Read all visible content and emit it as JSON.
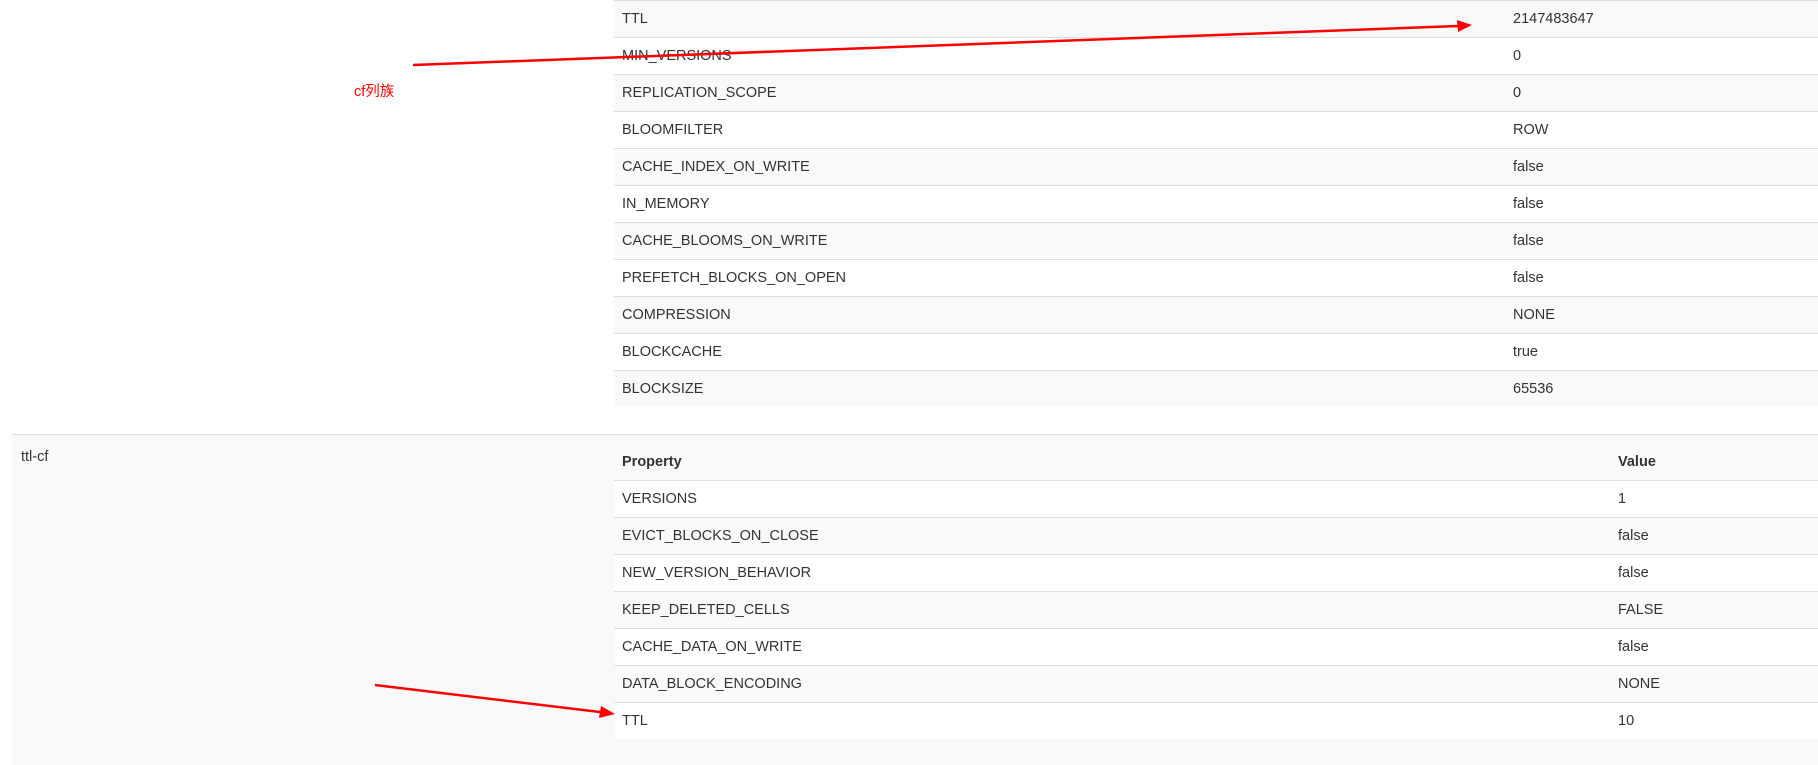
{
  "annotation": {
    "label": "cf列族",
    "color": "#ff0000"
  },
  "cf_family": {
    "rows": [
      {
        "property": "TTL",
        "value": "2147483647"
      },
      {
        "property": "MIN_VERSIONS",
        "value": "0"
      },
      {
        "property": "REPLICATION_SCOPE",
        "value": "0"
      },
      {
        "property": "BLOOMFILTER",
        "value": "ROW"
      },
      {
        "property": "CACHE_INDEX_ON_WRITE",
        "value": "false"
      },
      {
        "property": "IN_MEMORY",
        "value": "false"
      },
      {
        "property": "CACHE_BLOOMS_ON_WRITE",
        "value": "false"
      },
      {
        "property": "PREFETCH_BLOCKS_ON_OPEN",
        "value": "false"
      },
      {
        "property": "COMPRESSION",
        "value": "NONE"
      },
      {
        "property": "BLOCKCACHE",
        "value": "true"
      },
      {
        "property": "BLOCKSIZE",
        "value": "65536"
      }
    ]
  },
  "ttl_cf_family": {
    "name": "ttl-cf",
    "headers": {
      "property": "Property",
      "value": "Value"
    },
    "rows": [
      {
        "property": "VERSIONS",
        "value": "1"
      },
      {
        "property": "EVICT_BLOCKS_ON_CLOSE",
        "value": "false"
      },
      {
        "property": "NEW_VERSION_BEHAVIOR",
        "value": "false"
      },
      {
        "property": "KEEP_DELETED_CELLS",
        "value": "FALSE"
      },
      {
        "property": "CACHE_DATA_ON_WRITE",
        "value": "false"
      },
      {
        "property": "DATA_BLOCK_ENCODING",
        "value": "NONE"
      },
      {
        "property": "TTL",
        "value": "10"
      }
    ]
  }
}
